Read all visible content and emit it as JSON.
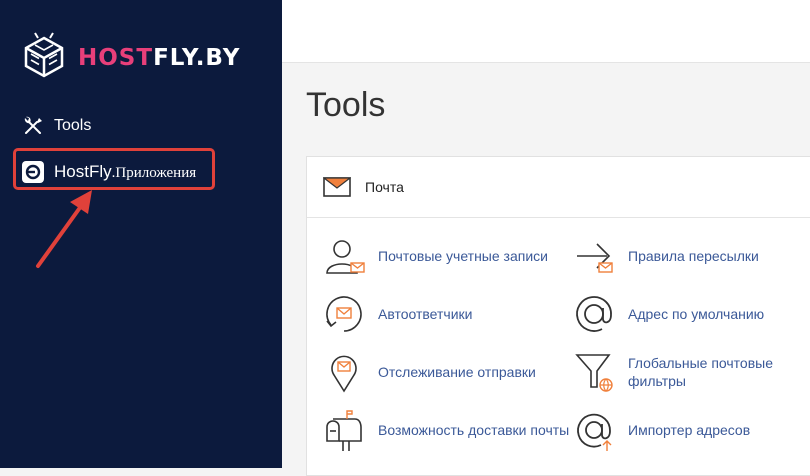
{
  "sidebar": {
    "logo": {
      "part1": "HOST",
      "part2": "FLY.BY"
    },
    "items": [
      {
        "label": "Tools",
        "icon": "tools-icon"
      },
      {
        "label_brand": "HostFly",
        "label_suffix": ".Приложения",
        "icon": "hostfly-app-icon",
        "highlighted": true
      }
    ]
  },
  "main": {
    "title": "Tools",
    "section": {
      "title": "Почта",
      "icon": "envelope-icon",
      "tools": [
        {
          "label": "Почтовые учетные записи",
          "icon": "email-accounts-icon"
        },
        {
          "label": "Правила пересылки",
          "icon": "forwarders-icon"
        },
        {
          "label": "Автоответчики",
          "icon": "autoresponders-icon"
        },
        {
          "label": "Адрес по умолчанию",
          "icon": "default-address-icon"
        },
        {
          "label": "Отслеживание отправки",
          "icon": "track-delivery-icon"
        },
        {
          "label": "Глобальные почтовые фильтры",
          "icon": "global-filters-icon"
        },
        {
          "label": "Возможность доставки почты",
          "icon": "deliverability-icon"
        },
        {
          "label": "Импортер адресов",
          "icon": "address-importer-icon"
        }
      ]
    }
  },
  "colors": {
    "sidebar_bg": "#0c1a3d",
    "brand_pink": "#e83f7a",
    "highlight_red": "#e0413a",
    "link_blue": "#3b5998",
    "accent_orange": "#f0803c"
  }
}
